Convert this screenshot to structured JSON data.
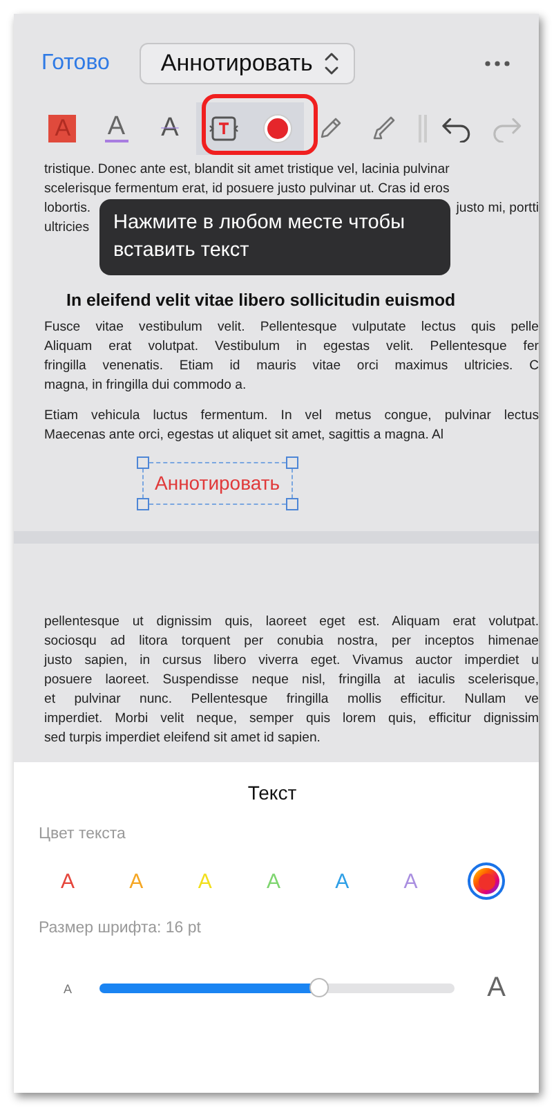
{
  "header": {
    "done": "Готово",
    "mode": "Аннотировать"
  },
  "toolbar": {
    "tools": [
      {
        "kind": "highlight",
        "label": "A",
        "selected": false
      },
      {
        "kind": "underline",
        "label": "A",
        "selected": false
      },
      {
        "kind": "strike",
        "label": "A",
        "selected": false
      },
      {
        "kind": "textbox",
        "selected": true
      },
      {
        "kind": "color",
        "selected": true,
        "color": "#e5262b"
      },
      {
        "kind": "pencil",
        "selected": false
      },
      {
        "kind": "marker",
        "selected": false
      }
    ],
    "history": [
      {
        "kind": "undo",
        "disabled": false
      },
      {
        "kind": "redo",
        "disabled": true
      }
    ]
  },
  "tooltip": "Нажмите в любом месте чтобы вставить текст",
  "document": {
    "top_lines": [
      [
        "tristique. Donec ante est, blandit sit amet tristique vel, lacinia pulvinar"
      ],
      [
        "scelerisque fermentum erat, id posuere justo pulvinar ut. Cras id eros"
      ],
      [
        "lobortis.",
        "justo mi, portti"
      ],
      [
        "ultricies"
      ]
    ],
    "heading": "In eleifend velit vitae libero sollicitudin euismod",
    "paragraphs": [
      {
        "lines": [
          "Fusce vitae vestibulum velit. Pellentesque vulputate lectus quis pelle",
          "Aliquam erat volutpat. Vestibulum in egestas velit. Pellentesque fer",
          "fringilla venenatis. Etiam id mauris vitae orci maximus ultricies. C",
          "magna, in fringilla dui commodo a."
        ]
      },
      {
        "lines": [
          "Etiam vehicula luctus fermentum. In vel metus congue, pulvinar lectus",
          "Maecenas ante orci, egestas ut aliquet sit amet, sagittis a magna. Al"
        ]
      }
    ],
    "annotation": "Аннотировать",
    "next_page": [
      {
        "lines": [
          "pellentesque ut dignissim quis, laoreet eget est. Aliquam erat volutpat.",
          "sociosqu ad litora torquent per conubia nostra, per inceptos himenae",
          "justo sapien, in cursus libero viverra eget. Vivamus auctor imperdiet u",
          "posuere laoreet. Suspendisse neque nisl, fringilla at iaculis scelerisque,",
          "et pulvinar nunc. Pellentesque fringilla mollis efficitur. Nullam ve",
          "imperdiet. Morbi velit neque, semper quis lorem quis, efficitur dignissim",
          "sed turpis imperdiet eleifend sit amet id sapien."
        ]
      }
    ]
  },
  "panel": {
    "title": "Текст",
    "color_label": "Цвет текста",
    "colors": [
      {
        "kind": "letter",
        "label": "A",
        "color": "#e5453b",
        "selected": false
      },
      {
        "kind": "letter",
        "label": "A",
        "color": "#f5a623",
        "selected": false
      },
      {
        "kind": "letter",
        "label": "A",
        "color": "#f2df1c",
        "selected": false
      },
      {
        "kind": "letter",
        "label": "A",
        "color": "#7ed56f",
        "selected": false
      },
      {
        "kind": "letter",
        "label": "A",
        "color": "#2e9fe6",
        "selected": false
      },
      {
        "kind": "letter",
        "label": "A",
        "color": "#a98ee0",
        "selected": false
      },
      {
        "kind": "wheel",
        "selected": true
      }
    ],
    "size_label": "Размер шрифта: 16 pt",
    "slider": {
      "min_label": "A",
      "max_label": "A",
      "level": 0.62
    }
  }
}
